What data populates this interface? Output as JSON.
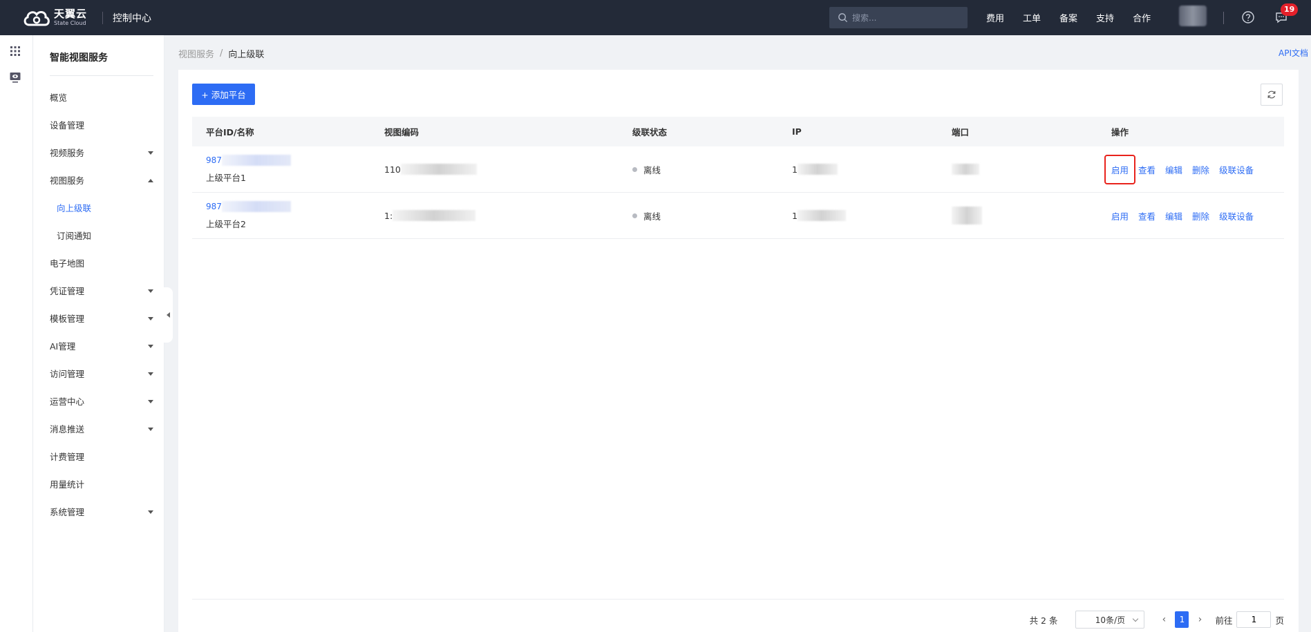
{
  "header": {
    "brand_cn": "天翼云",
    "brand_en": "State Cloud",
    "console_title": "控制中心",
    "search_placeholder": "搜索...",
    "nav": [
      "费用",
      "工单",
      "备案",
      "支持",
      "合作"
    ],
    "message_count": "19"
  },
  "sidebar": {
    "title": "智能视图服务",
    "items": [
      {
        "label": "概览",
        "expandable": false
      },
      {
        "label": "设备管理",
        "expandable": false
      },
      {
        "label": "视频服务",
        "expandable": true,
        "expanded": false
      },
      {
        "label": "视图服务",
        "expandable": true,
        "expanded": true
      },
      {
        "label": "向上级联",
        "sub": true,
        "active": true
      },
      {
        "label": "订阅通知",
        "sub": true
      },
      {
        "label": "电子地图",
        "expandable": false
      },
      {
        "label": "凭证管理",
        "expandable": true
      },
      {
        "label": "模板管理",
        "expandable": true
      },
      {
        "label": "AI管理",
        "expandable": true
      },
      {
        "label": "访问管理",
        "expandable": true
      },
      {
        "label": "运营中心",
        "expandable": true
      },
      {
        "label": "消息推送",
        "expandable": true
      },
      {
        "label": "计费管理",
        "expandable": false
      },
      {
        "label": "用量统计",
        "expandable": false
      },
      {
        "label": "系统管理",
        "expandable": true
      }
    ]
  },
  "breadcrumb": {
    "parent": "视图服务",
    "separator": "/",
    "current": "向上级联"
  },
  "api_doc": "API文档",
  "toolbar": {
    "add_label": "+ 添加平台"
  },
  "table": {
    "columns": [
      "平台ID/名称",
      "视图编码",
      "级联状态",
      "IP",
      "端口",
      "操作"
    ],
    "rows": [
      {
        "id_prefix": "987",
        "name": "上级平台1",
        "code_prefix": "110",
        "status": "离线",
        "ip_prefix": "1",
        "port": "",
        "highlight_first_op": true
      },
      {
        "id_prefix": "987",
        "name": "上级平台2",
        "code_prefix": "1:",
        "status": "离线",
        "ip_prefix": "1",
        "port": "",
        "highlight_first_op": false
      }
    ],
    "actions": [
      "启用",
      "查看",
      "编辑",
      "删除",
      "级联设备"
    ]
  },
  "pagination": {
    "total": "共 2 条",
    "page_size": "10条/页",
    "current_page": "1",
    "goto_label": "前往",
    "goto_value": "1",
    "goto_unit": "页"
  },
  "colors": {
    "topbar": "#232a38",
    "primary": "#2d6cf4",
    "highlight_box": "#e8221b",
    "badge": "#e4202a"
  }
}
